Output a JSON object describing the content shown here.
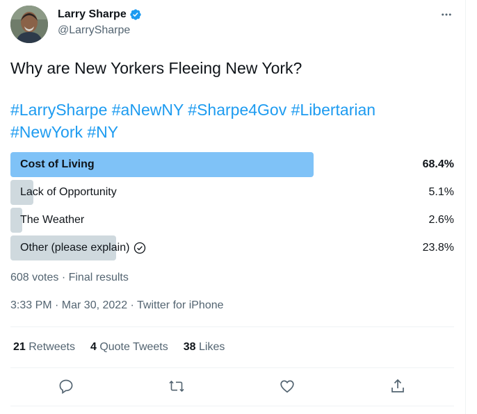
{
  "author": {
    "name": "Larry Sharpe",
    "handle": "@LarrySharpe",
    "verified": true
  },
  "tweet": {
    "question": "Why are New Yorkers Fleeing New York?",
    "hashtags_line1": [
      "#LarrySharpe",
      "#aNewNY",
      "#Sharpe4Gov",
      "#Libertarian"
    ],
    "hashtags_line2": [
      "#NewYork",
      "#NY"
    ]
  },
  "poll": {
    "options": [
      {
        "label": "Cost of Living",
        "percent": "68.4%",
        "value": 68.4,
        "winner": true
      },
      {
        "label": "Lack of Opportunity",
        "percent": "5.1%",
        "value": 5.1,
        "winner": false
      },
      {
        "label": "The Weather",
        "percent": "2.6%",
        "value": 2.6,
        "winner": false
      },
      {
        "label": "Other (please explain)",
        "percent": "23.8%",
        "value": 23.8,
        "winner": false,
        "voted": true
      }
    ],
    "meta": "608 votes · Final results"
  },
  "timestamp": "3:33 PM · Mar 30, 2022 · Twitter for iPhone",
  "stats": {
    "retweets_count": "21",
    "retweets_label": "Retweets",
    "quotes_count": "4",
    "quotes_label": "Quote Tweets",
    "likes_count": "38",
    "likes_label": "Likes"
  },
  "colors": {
    "accent": "#1d9bf0",
    "winner_bar": "#7fc2f7",
    "bar": "#cfd9de",
    "muted_text": "#536471"
  },
  "icons": [
    "verified-badge-icon",
    "more-icon",
    "check-circle-icon",
    "reply-icon",
    "retweet-icon",
    "like-icon",
    "share-icon"
  ]
}
